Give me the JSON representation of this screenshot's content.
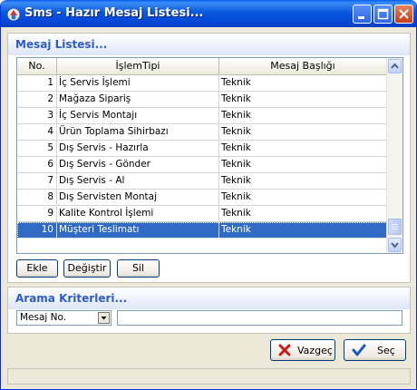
{
  "window": {
    "title": "Sms - Hazır Mesaj Listesi..."
  },
  "list_panel": {
    "title": "Mesaj Listesi...",
    "columns": [
      "No.",
      "İşlemTipi",
      "Mesaj Başlığı"
    ],
    "rows": [
      {
        "no": "1",
        "islem": "İç Servis İşlemi",
        "mesaj": "Teknik"
      },
      {
        "no": "2",
        "islem": "Mağaza Sipariş",
        "mesaj": "Teknik"
      },
      {
        "no": "3",
        "islem": "İç Servis Montajı",
        "mesaj": "Teknik"
      },
      {
        "no": "4",
        "islem": "Ürün Toplama Sihirbazı",
        "mesaj": "Teknik"
      },
      {
        "no": "5",
        "islem": "Dış Servis - Hazırla",
        "mesaj": "Teknik"
      },
      {
        "no": "6",
        "islem": "Dış Servis - Gönder",
        "mesaj": "Teknik"
      },
      {
        "no": "7",
        "islem": "Dış Servis - Al",
        "mesaj": "Teknik"
      },
      {
        "no": "8",
        "islem": "Dış Servisten Montaj",
        "mesaj": "Teknik"
      },
      {
        "no": "9",
        "islem": "Kalite Kontrol İşlemi",
        "mesaj": "Teknik"
      },
      {
        "no": "10",
        "islem": "Müşteri Teslimatı",
        "mesaj": "Teknik"
      }
    ],
    "selected_row": "10"
  },
  "actions": {
    "add": "Ekle",
    "edit": "Değiştir",
    "delete": "Sil"
  },
  "search_panel": {
    "title": "Arama Kriterleri...",
    "criteria_value": "Mesaj No.",
    "search_value": ""
  },
  "footer": {
    "cancel": "Vazgeç",
    "select": "Seç"
  },
  "colors": {
    "title_bar": "#0a58dd",
    "selection": "#316ac5",
    "section_title": "#2e5bc7"
  },
  "icons": [
    "app-icon",
    "minimize-icon",
    "maximize-icon",
    "close-icon",
    "scroll-up-icon",
    "scroll-down-icon",
    "dropdown-arrow-icon",
    "cancel-x-icon",
    "check-icon"
  ]
}
